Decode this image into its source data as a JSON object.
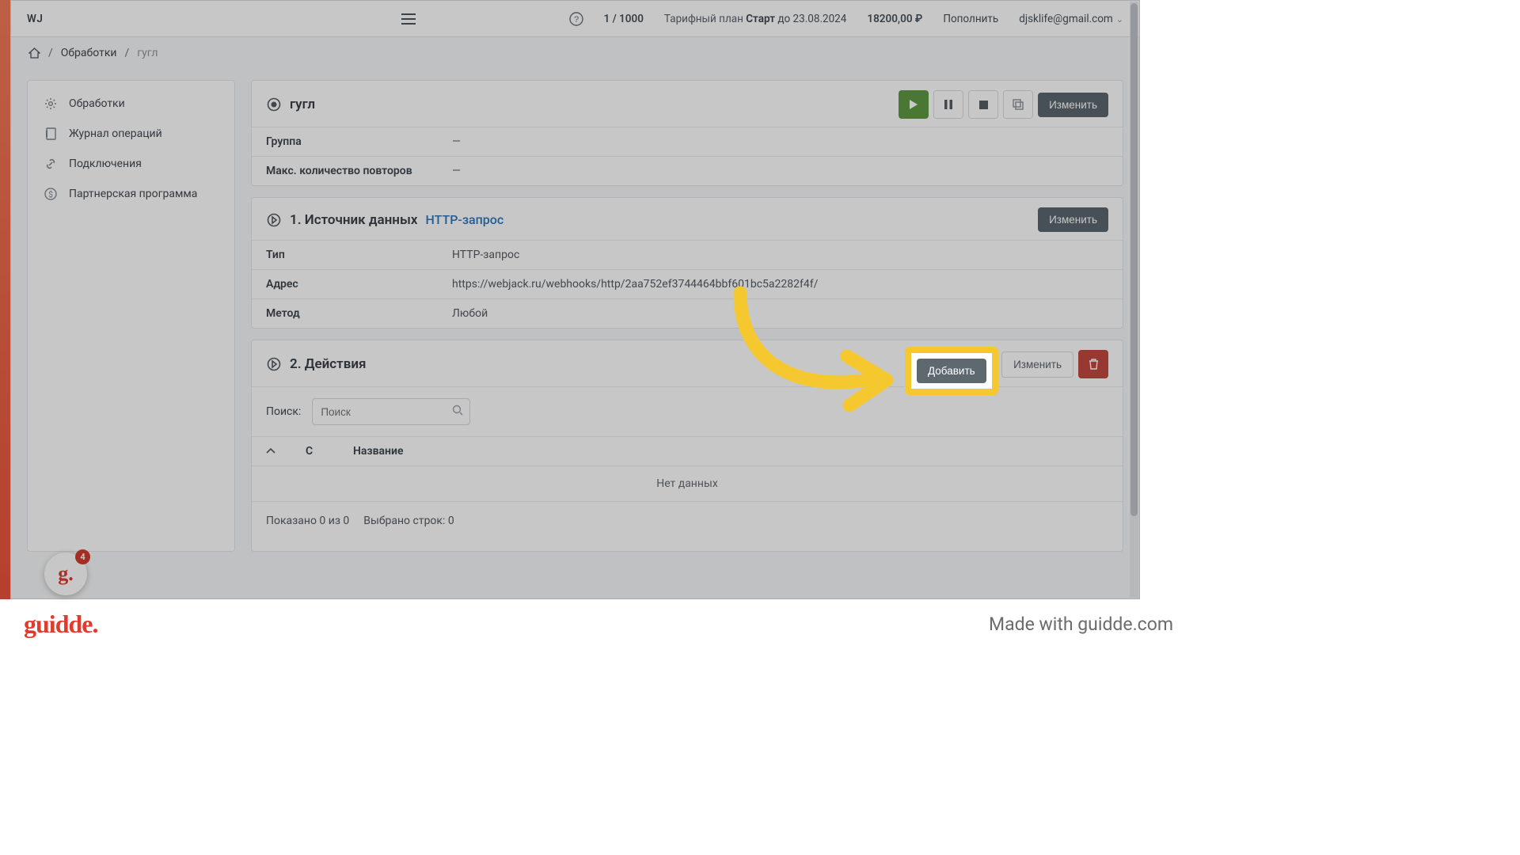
{
  "header": {
    "logo": "WJ",
    "counter": "1 / 1000",
    "plan_prefix": "Тарифный план ",
    "plan_name": "Старт",
    "plan_suffix": " до 23.08.2024",
    "balance": "18200,00",
    "currency": "₽",
    "topup": "Пополнить",
    "email": "djsklife@gmail.com"
  },
  "breadcrumb": {
    "items": [
      "Обработки"
    ],
    "current": "гугл"
  },
  "sidebar": {
    "items": [
      {
        "icon": "gear",
        "label": "Обработки"
      },
      {
        "icon": "journal",
        "label": "Журнал операций"
      },
      {
        "icon": "link",
        "label": "Подключения"
      },
      {
        "icon": "dollar",
        "label": "Партнерская программа"
      }
    ]
  },
  "section_main": {
    "title": "гугл",
    "edit": "Изменить",
    "rows": [
      {
        "k": "Группа",
        "v": "—"
      },
      {
        "k": "Макс. количество повторов",
        "v": "—"
      }
    ]
  },
  "section_source": {
    "num": "1.",
    "title": "Источник данных",
    "subtitle": "HTTP-запрос",
    "edit": "Изменить",
    "rows": [
      {
        "k": "Тип",
        "v": "HTTP-запрос"
      },
      {
        "k": "Адрес",
        "v": "https://webjack.ru/webhooks/http/2aa752ef3744464bbf601bc5a2282f4f/"
      },
      {
        "k": "Метод",
        "v": "Любой"
      }
    ]
  },
  "section_actions": {
    "num": "2.",
    "title": "Действия",
    "add": "Добавить",
    "edit": "Изменить",
    "search_label": "Поиск:",
    "search_placeholder": "Поиск",
    "cols": {
      "c": "С",
      "name": "Название"
    },
    "empty": "Нет данных",
    "shown": "Показано 0 из 0",
    "selected": "Выбрано строк: 0"
  },
  "footer": {
    "brand": "guidde.",
    "made": "Made with guidde.com"
  },
  "bubble_badge": "4",
  "colors": {
    "accent_yellow": "#f6c82f"
  }
}
